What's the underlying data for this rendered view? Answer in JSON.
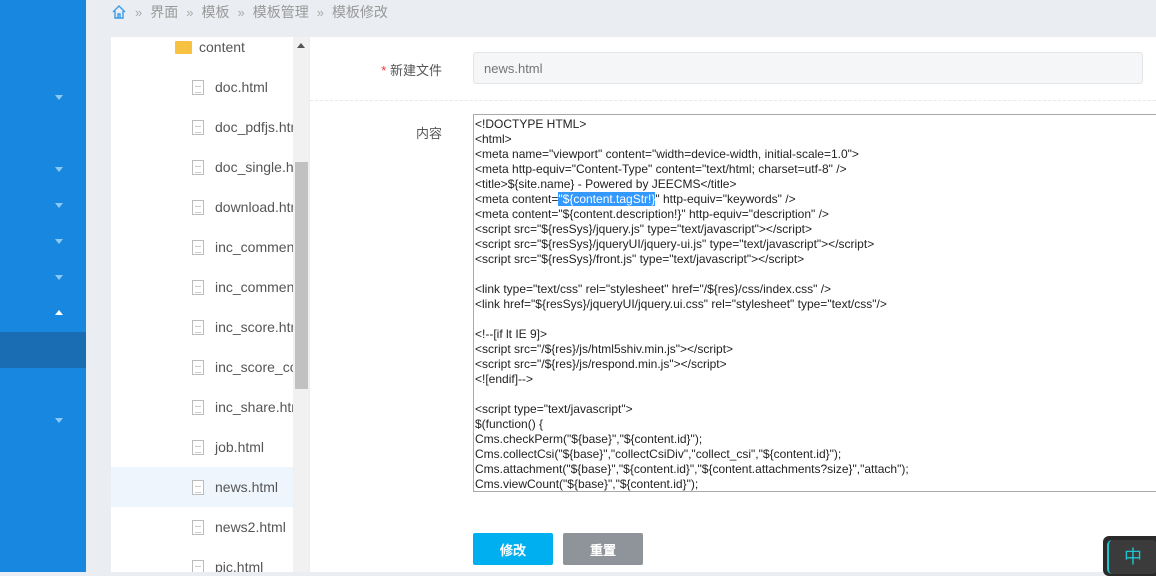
{
  "breadcrumb": {
    "items": [
      "界面",
      "模板",
      "模板管理",
      "模板修改"
    ]
  },
  "tree": {
    "folder": "content",
    "files": [
      "doc.html",
      "doc_pdfjs.html",
      "doc_single.html",
      "download.html",
      "inc_comment.html",
      "inc_comment_list.html",
      "inc_score.html",
      "inc_score_common.html",
      "inc_share.html",
      "job.html",
      "news.html",
      "news2.html",
      "pic.html"
    ],
    "selected": "news.html"
  },
  "form": {
    "filename_label": "新建文件",
    "filename_required": "*",
    "filename_placeholder": "news.html",
    "content_label": "内容",
    "code_before": "<!DOCTYPE HTML>\n<html>\n<meta name=\"viewport\" content=\"width=device-width, initial-scale=1.0\">\n<meta http-equiv=\"Content-Type\" content=\"text/html; charset=utf-8\" />\n<title>${site.name} - Powered by JEECMS</title>\n<meta content=",
    "code_selected": "\"${content.tagStr!}",
    "code_after": "\" http-equiv=\"keywords\" />\n<meta content=\"${content.description!}\" http-equiv=\"description\" />\n<script src=\"${resSys}/jquery.js\" type=\"text/javascript\"></script>\n<script src=\"${resSys}/jqueryUI/jquery-ui.js\" type=\"text/javascript\"></script>\n<script src=\"${resSys}/front.js\" type=\"text/javascript\"></script>\n\n<link type=\"text/css\" rel=\"stylesheet\" href=\"/${res}/css/index.css\" />\n<link href=\"${resSys}/jqueryUI/jquery.ui.css\" rel=\"stylesheet\" type=\"text/css\"/>\n\n<!--[if lt IE 9]>\n<script src=\"/${res}/js/html5shiv.min.js\"></script>\n<script src=\"/${res}/js/respond.min.js\"></script>\n<![endif]-->\n\n<script type=\"text/javascript\">\n$(function() {\nCms.checkPerm(\"${base}\",\"${content.id}\");\nCms.collectCsi(\"${base}\",\"collectCsiDiv\",\"collect_csi\",\"${content.id}\");\nCms.attachment(\"${base}\",\"${content.id}\",\"${content.attachments?size}\",\"attach\");\nCms.viewCount(\"${base}\",\"${content.id}\");",
    "submit_label": "修改",
    "reset_label": "重置"
  },
  "ime": {
    "label": "中"
  },
  "colors": {
    "sidebar": "#1787e0",
    "primary": "#00aff0",
    "reset": "#8f949a"
  }
}
